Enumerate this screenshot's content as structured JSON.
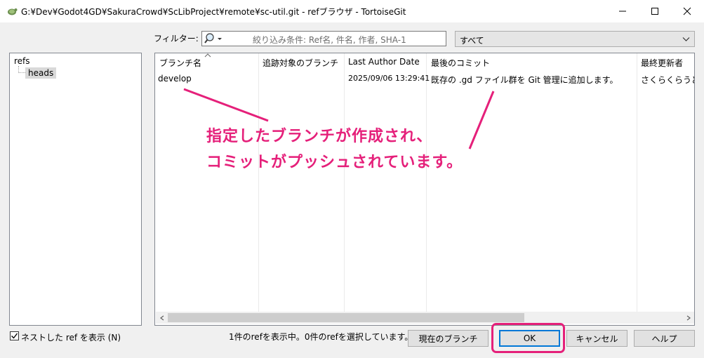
{
  "window": {
    "title": "G:¥Dev¥Godot4GD¥SakuraCrowd¥ScLibProject¥remote¥sc-util.git - refブラウザ - TortoiseGit",
    "icon": "tortoisegit-app-icon"
  },
  "filter": {
    "label": "フィルター:",
    "placeholder": "絞り込み条件: Ref名, 件名, 作者, SHA-1",
    "search_icon": "magnifier-icon",
    "scope_value": "すべて"
  },
  "tree": {
    "root": "refs",
    "child": "heads"
  },
  "list": {
    "columns": [
      "ブランチ名",
      "追跡対象のブランチ",
      "Last Author Date",
      "最後のコミット",
      "最終更新者"
    ],
    "rows": [
      {
        "branch": "develop",
        "tracked": "",
        "last_author_date": "2025/09/06 13:29:41",
        "last_commit": "既存の .gd ファイル群を Git 管理に追加します。",
        "last_updater": "さくらくらうど"
      }
    ]
  },
  "bottom": {
    "nested_checkbox_label": "ネストした ref を表示 (N)",
    "nested_checked": true,
    "status": "1件のrefを表示中。0件のrefを選択しています。",
    "btn_current_branch": "現在のブランチ",
    "btn_ok": "OK",
    "btn_cancel": "キャンセル",
    "btn_help": "ヘルプ"
  },
  "annotation": {
    "line1": "指定したブランチが作成され、",
    "line2": "コミットがプッシュされています。",
    "color": "#e5207a"
  }
}
